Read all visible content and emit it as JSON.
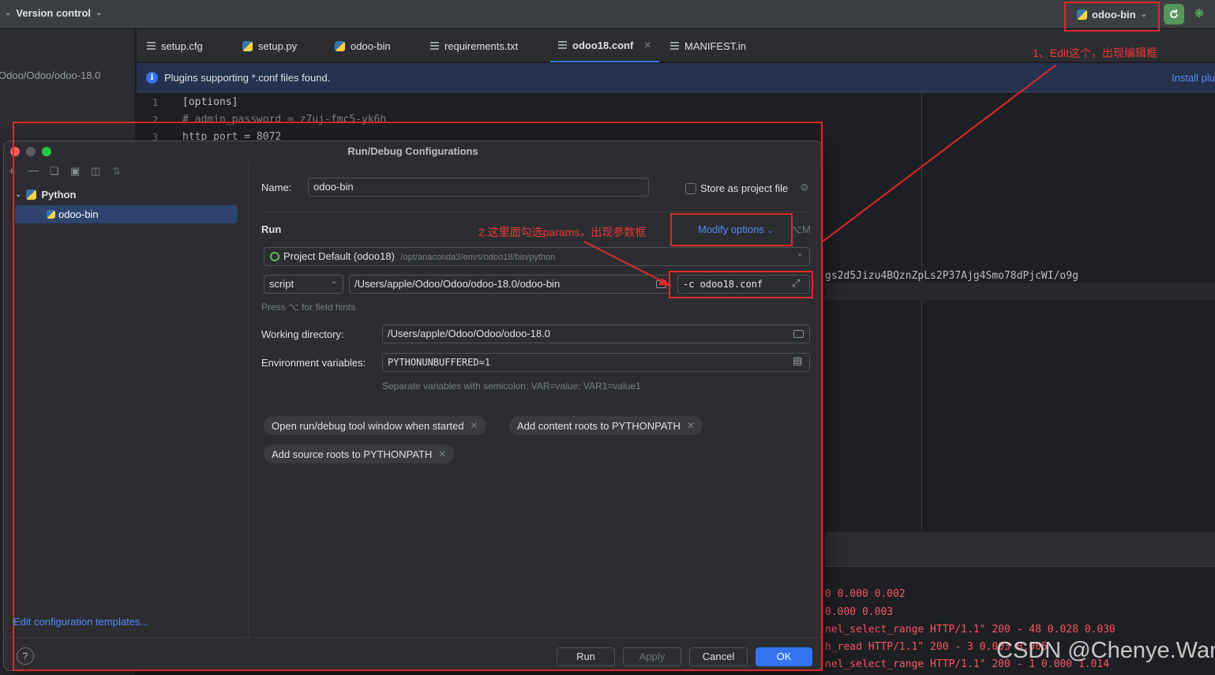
{
  "topbar": {
    "version_control": "Version control",
    "run_config": "odoo-bin"
  },
  "project": {
    "path": "Odoo/Odoo/odoo-18.0"
  },
  "tabs": [
    {
      "label": "setup.cfg",
      "icon": "text-file-icon"
    },
    {
      "label": "setup.py",
      "icon": "python-file-icon"
    },
    {
      "label": "odoo-bin",
      "icon": "python-file-icon"
    },
    {
      "label": "requirements.txt",
      "icon": "text-file-icon"
    },
    {
      "label": "odoo18.conf",
      "icon": "text-file-icon",
      "active": true
    },
    {
      "label": "MANIFEST.in",
      "icon": "text-file-icon"
    }
  ],
  "banner": {
    "text": "Plugins supporting *.conf files found.",
    "link": "Install plu"
  },
  "editor": {
    "lines": [
      {
        "num": "1",
        "text": "[options]"
      },
      {
        "num": "2",
        "text": "# admin_password = z7uj-fmc5-yk6h"
      },
      {
        "num": "3",
        "text": "http_port = 8072"
      }
    ],
    "right_text": "gs2d5Jizu4BQznZpLs2P37Ajg4Smo78dPjcWI/o9g"
  },
  "console": {
    "lines": [
      "0 0.000 0.002",
      "0.000 0.003",
      "nel_select_range HTTP/1.1\" 200 - 48 0.028 0.030",
      "h_read HTTP/1.1\" 200 - 3 0.003 0.005",
      "nel_select_range HTTP/1.1\" 200 - 1 0.000 1.014"
    ]
  },
  "dialog": {
    "title": "Run/Debug Configurations",
    "tree": {
      "group": "Python",
      "item": "odoo-bin"
    },
    "edit_templates": "Edit configuration templates...",
    "name_label": "Name:",
    "name_value": "odoo-bin",
    "store_label": "Store as project file",
    "run_label": "Run",
    "modify_options": "Modify options",
    "modify_shortcut": "⌥M",
    "interpreter": {
      "name": "Project Default (odoo18)",
      "path": "/opt/anaconda3/envs/odoo18/bin/python"
    },
    "script_mode": "script",
    "script_path": "/Users/apple/Odoo/Odoo/odoo-18.0/odoo-bin",
    "params": "-c odoo18.conf",
    "field_hint": "Press ⌥ for field hints",
    "workdir_label": "Working directory:",
    "workdir_value": "/Users/apple/Odoo/Odoo/odoo-18.0",
    "env_label": "Environment variables:",
    "env_value": "PYTHONUNBUFFERED=1",
    "env_hint": "Separate variables with semicolon: VAR=value; VAR1=value1",
    "chips": [
      "Open run/debug tool window when started",
      "Add content roots to PYTHONPATH",
      "Add source roots to PYTHONPATH"
    ],
    "buttons": {
      "run": "Run",
      "apply": "Apply",
      "cancel": "Cancel",
      "ok": "OK",
      "help": "?"
    }
  },
  "annotations": {
    "note1": "1、Edit这个，出现编辑框",
    "note2": "2.这里面勾选params，出现参数框",
    "color": "#e0282b"
  },
  "watermark": "CSDN @Chenye.Wan"
}
